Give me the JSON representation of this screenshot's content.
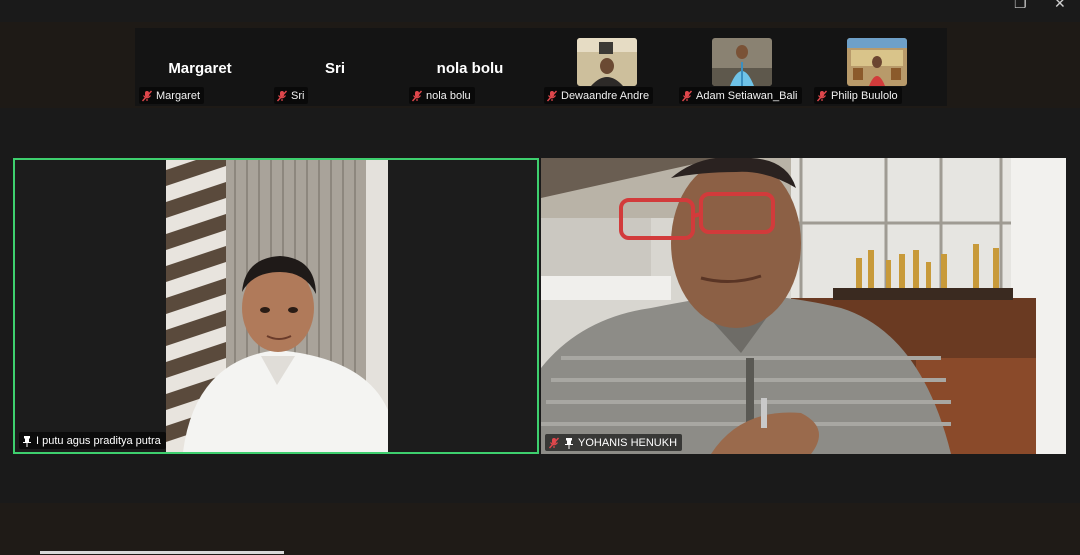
{
  "window": {
    "restore_glyph": "❐",
    "close_glyph": "✕"
  },
  "gallery": {
    "participants": [
      {
        "display_name": "Margaret",
        "label": "Margaret",
        "muted": true,
        "video": false
      },
      {
        "display_name": "Sri",
        "label": "Sri",
        "muted": true,
        "video": false
      },
      {
        "display_name": "nola bolu",
        "label": "nola bolu",
        "muted": true,
        "video": false
      },
      {
        "display_name": "",
        "label": "Dewaandre Andre",
        "muted": true,
        "video": true
      },
      {
        "display_name": "",
        "label": "Adam Setiawan_Bali",
        "muted": true,
        "video": true
      },
      {
        "display_name": "",
        "label": "Philip Buulolo",
        "muted": true,
        "video": true
      }
    ]
  },
  "main": {
    "left_tile": {
      "name": "I putu agus praditya putra",
      "pinned": true,
      "active_speaker": true
    },
    "right_tile": {
      "name": "YOHANIS HENUKH",
      "pinned": true,
      "muted": true
    }
  },
  "colors": {
    "active_speaker_border": "#3ecf6e",
    "mute_icon": "#e0474c"
  },
  "icons": {
    "mic_off": "mic-off-icon",
    "pin": "pin-icon"
  }
}
